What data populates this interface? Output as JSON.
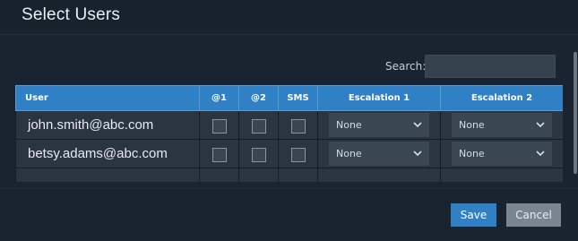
{
  "dialog": {
    "title": "Select Users"
  },
  "search": {
    "label": "Search:",
    "value": "",
    "placeholder": ""
  },
  "table": {
    "columns": [
      "User",
      "@1",
      "@2",
      "SMS",
      "Escalation 1",
      "Escalation 2"
    ],
    "rows": [
      {
        "user": "john.smith@abc.com",
        "at1": false,
        "at2": false,
        "sms": false,
        "escalation1": "None",
        "escalation2": "None"
      },
      {
        "user": "betsy.adams@abc.com",
        "at1": false,
        "at2": false,
        "sms": false,
        "escalation1": "None",
        "escalation2": "None"
      }
    ]
  },
  "footer": {
    "save_label": "Save",
    "cancel_label": "Cancel"
  },
  "colors": {
    "header_blue": "#2f80c4",
    "background": "#1a2430",
    "cancel_gray": "#7b858f"
  },
  "icons": {
    "checkbox": "checkbox-icon",
    "dropdown": "chevron-down-icon"
  }
}
